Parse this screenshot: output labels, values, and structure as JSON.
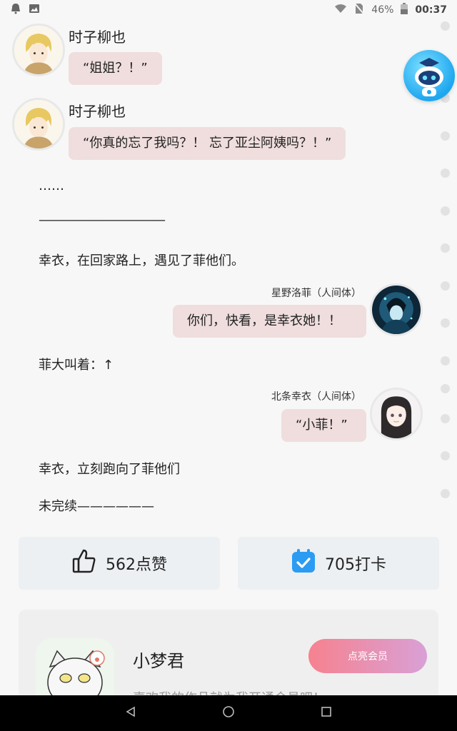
{
  "status_bar": {
    "battery_percent": "46%",
    "time": "00:37"
  },
  "chat": {
    "msg1": {
      "sender": "时子柳也",
      "text": "“姐姐？！”"
    },
    "msg2": {
      "sender": "时子柳也",
      "text": "“你真的忘了我吗？！ 忘了亚尘阿姨吗？！”"
    },
    "narr1": "……",
    "narr2": "———————————",
    "narr3": "幸衣，在回家路上，遇见了菲他们。",
    "msg3": {
      "sender": "星野洛菲（人间体）",
      "text": "你们，快看，是幸衣她！！"
    },
    "narr4": "菲大叫着：↑",
    "msg4": {
      "sender": "北条幸衣（人间体）",
      "text": "“小菲！”"
    },
    "narr5": "幸衣，立刻跑向了菲他们",
    "narr6": "未完续——————"
  },
  "actions": {
    "like_label": "562点赞",
    "checkin_label": "705打卡"
  },
  "author": {
    "name": "小梦君",
    "subtitle": "喜欢我的作品就为我开通会员吧！",
    "member_button": "点亮会员"
  },
  "colors": {
    "bubble": "#efdedd",
    "accent_blue": "#2b9cf2",
    "member_gradient_start": "#f6828f",
    "member_gradient_end": "#d9a0d6"
  }
}
